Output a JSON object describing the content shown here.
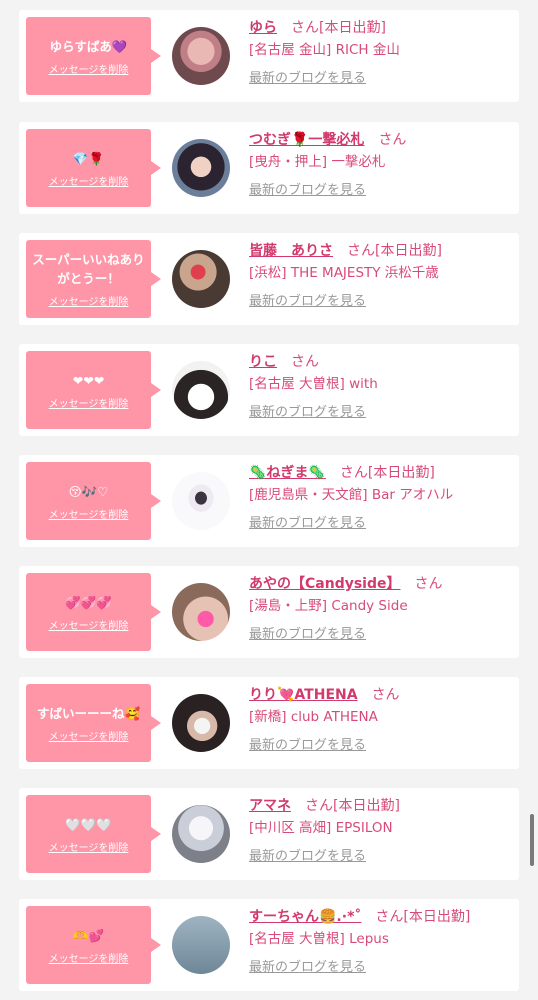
{
  "theme": {
    "accent": "#ff96a8",
    "name_color": "#d13a6c",
    "text_color": "#d84b78",
    "link_gray": "#999999",
    "background": "#f3f3f3"
  },
  "delete_label": "メッセージを削除",
  "blog_label": "最新のブログを見る",
  "entries": [
    {
      "message": "ゆらすぱあ💜",
      "name": "ゆら",
      "honorific": "さん",
      "status": "[本日出勤]",
      "shop": "[名古屋 金山] RICH 金山"
    },
    {
      "message": "💎🌹",
      "name": "つむぎ🌹一撃必札",
      "honorific": "さん",
      "status": "",
      "shop": "[曳舟・押上] 一撃必札"
    },
    {
      "message": "スーパーいいねありがとうー！",
      "name": "皆藤　ありさ",
      "honorific": "さん",
      "status": "[本日出勤]",
      "shop": "[浜松] THE MAJESTY 浜松千歳"
    },
    {
      "message": "❤❤❤",
      "name": "りこ",
      "honorific": "さん",
      "status": "",
      "shop": "[名古屋 大曽根] with"
    },
    {
      "message": "😚🎶♡",
      "name": "🦠ねぎま🦠",
      "honorific": "さん",
      "status": "[本日出勤]",
      "shop": "[鹿児島県・天文館] Bar アオハル"
    },
    {
      "message": "💞💞💞",
      "name": "あやの【Candyside】",
      "honorific": "さん",
      "status": "",
      "shop": "[湯島・上野] Candy Side"
    },
    {
      "message": "すばいーーーね🥰",
      "name": "りり💘ATHENA",
      "honorific": "さん",
      "status": "",
      "shop": "[新橋] club ATHENA"
    },
    {
      "message": "🤍🤍🤍",
      "name": "アマネ",
      "honorific": "さん",
      "status": "[本日出勤]",
      "shop": "[中川区 高畑] EPSILON"
    },
    {
      "message": "🫶💕",
      "name": "すーちゃん🍔.·*˚",
      "honorific": "さん",
      "status": "[本日出勤]",
      "shop": "[名古屋 大曽根] Lepus"
    }
  ]
}
